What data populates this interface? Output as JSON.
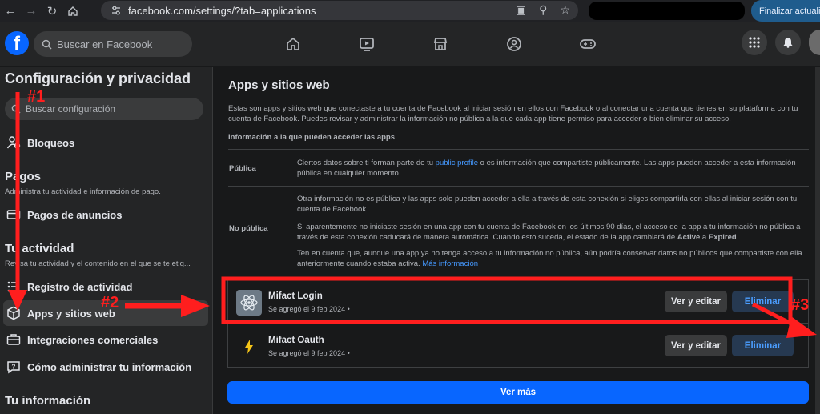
{
  "browser": {
    "url": "facebook.com/settings/?tab=applications",
    "update_button": "Finalizar actualiz"
  },
  "topbar": {
    "logo": "f",
    "search_placeholder": "Buscar en Facebook"
  },
  "sidebar": {
    "title": "Configuración y privacidad",
    "search_placeholder": "Buscar configuración",
    "bloqueos": "Bloqueos",
    "pagos_heading": "Pagos",
    "pagos_sub": "Administra tu actividad e información de pago.",
    "pagos_anuncios": "Pagos de anuncios",
    "actividad_heading": "Tu actividad",
    "actividad_sub": "Revisa tu actividad y el contenido en el que se te etiq...",
    "registro": "Registro de actividad",
    "apps": "Apps y sitios web",
    "integraciones": "Integraciones comerciales",
    "como_administrar": "Cómo administrar tu información",
    "info_heading": "Tu información"
  },
  "main": {
    "title": "Apps y sitios web",
    "description": "Estas son apps y sitios web que conectaste a tu cuenta de Facebook al iniciar sesión en ellos con Facebook o al conectar una cuenta que tienes en su plataforma con tu cuenta de Facebook. Puedes revisar y administrar la información no pública a la que cada app tiene permiso para acceder o bien eliminar su acceso.",
    "subheading": "Información a la que pueden acceder las apps",
    "publica": {
      "label": "Pública",
      "text_a": "Ciertos datos sobre ti forman parte de tu ",
      "link": "public profile",
      "text_b": " o es información que compartiste públicamente. Las apps pueden acceder a esta información pública en cualquier momento."
    },
    "no_publica": {
      "label": "No pública",
      "p1": "Otra información no es pública y las apps solo pueden acceder a ella a través de esta conexión si eliges compartirla con ellas al iniciar sesión con tu cuenta de Facebook.",
      "p2_a": "Si aparentemente no iniciaste sesión en una app con tu cuenta de Facebook en los últimos 90 días, el acceso de la app a tu información no pública a través de esta conexión caducará de manera automática. Cuando esto suceda, el estado de la app cambiará de ",
      "p2_active": "Active",
      "p2_mid": " a ",
      "p2_expired": "Expired",
      "p2_end": ".",
      "p3_a": "Ten en cuenta que, aunque una app ya no tenga acceso a tu información no pública, aún podría conservar datos no públicos que compartiste con ella anteriormente cuando estaba activa. ",
      "p3_link": "Más información"
    },
    "apps": [
      {
        "name": "Mifact Login",
        "date": "Se agregó el 9 feb 2024  •",
        "edit": "Ver y editar",
        "remove": "Eliminar"
      },
      {
        "name": "Mifact Oauth",
        "date": "Se agregó el 9 feb 2024  •",
        "edit": "Ver y editar",
        "remove": "Eliminar"
      }
    ],
    "ver_mas": "Ver más"
  },
  "annotations": {
    "n1": "#1",
    "n2": "#2",
    "n3": "#3",
    "color": "#ff1e1e"
  }
}
